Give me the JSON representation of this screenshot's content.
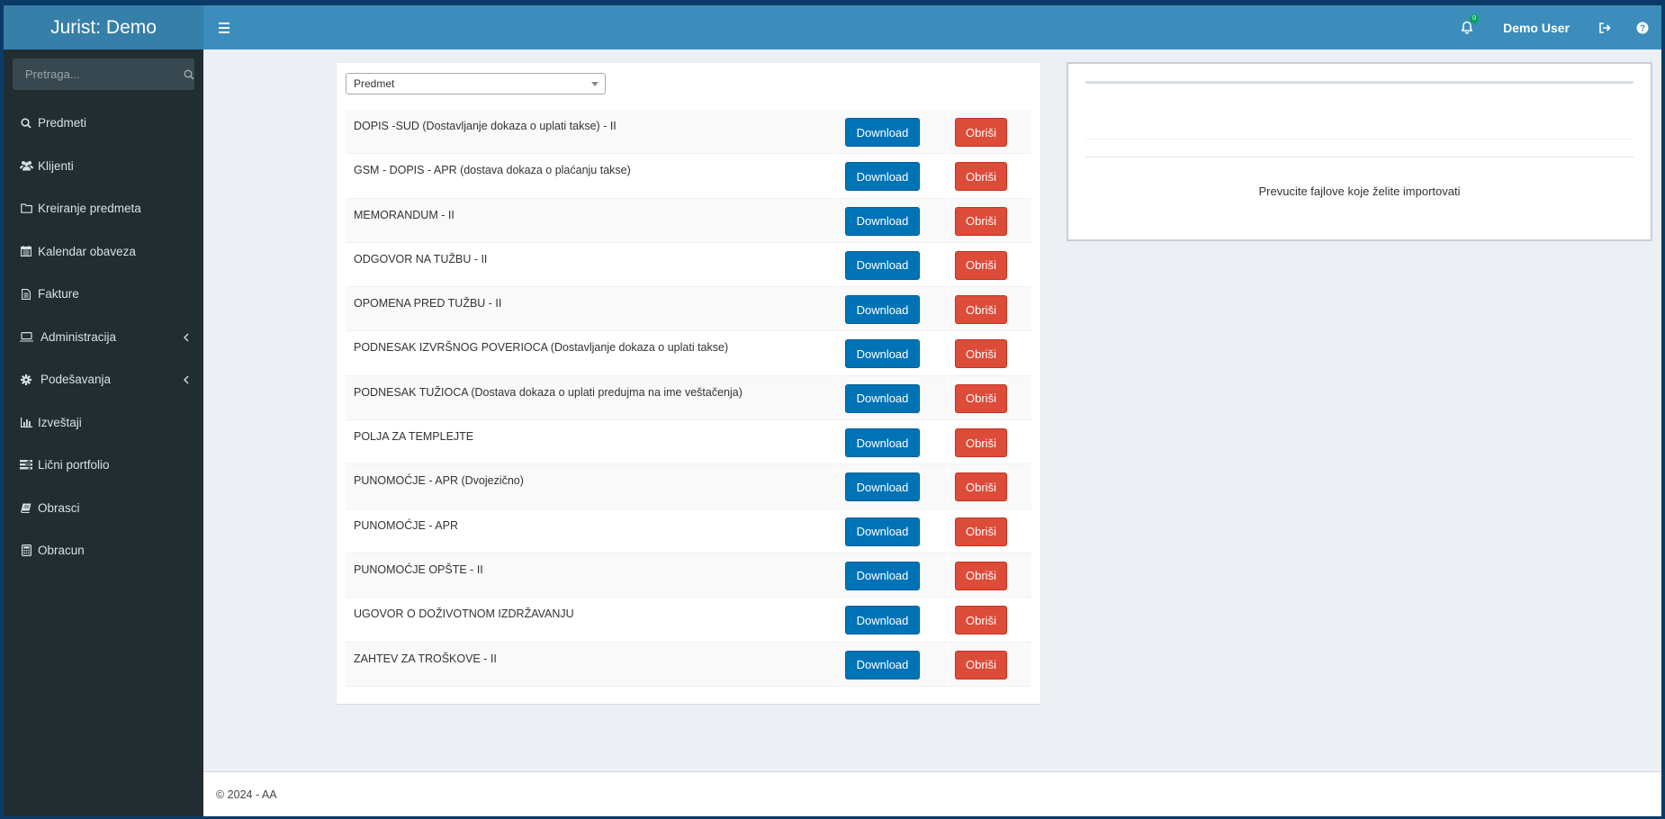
{
  "app": {
    "brand": "Jurist: Demo"
  },
  "header": {
    "notification_count": "0",
    "user_name": "Demo User"
  },
  "sidebar": {
    "search_placeholder": "Pretraga...",
    "items": [
      {
        "label": "Predmeti",
        "icon": "search-icon"
      },
      {
        "label": "Klijenti",
        "icon": "users-icon"
      },
      {
        "label": "Kreiranje predmeta",
        "icon": "folder-icon"
      },
      {
        "label": "Kalendar obaveza",
        "icon": "calendar-icon"
      },
      {
        "label": "Fakture",
        "icon": "document-icon"
      },
      {
        "label": "Administracija",
        "icon": "laptop-icon",
        "expandable": true
      },
      {
        "label": "Podešavanja",
        "icon": "gear-icon",
        "expandable": true
      },
      {
        "label": "Izveštaji",
        "icon": "bar-chart-icon"
      },
      {
        "label": "Lični portfolio",
        "icon": "portfolio-icon"
      },
      {
        "label": "Obrasci",
        "icon": "book-icon"
      },
      {
        "label": "Obracun",
        "icon": "calculator-icon"
      }
    ]
  },
  "templates": {
    "select_value": "Predmet",
    "download_label": "Download",
    "delete_label": "Obriši",
    "rows": [
      "DOPIS -SUD (Dostavljanje dokaza o uplati takse) - II",
      "GSM - DOPIS - APR (dostava dokaza o plaćanju takse)",
      "MEMORANDUM - II",
      "ODGOVOR NA TUŽBU - II",
      "OPOMENA PRED TUŽBU - II",
      "PODNESAK IZVRŠNOG POVERIOCA (Dostavljanje dokaza o uplati takse)",
      "PODNESAK TUŽIOCA (Dostava dokaza o uplati predujma na ime veštačenja)",
      "POLJA ZA TEMPLEJTE",
      "PUNOMOĆJE - APR (Dvojezično)",
      "PUNOMOĆJE - APR",
      "PUNOMOĆJE OPŠTE - II",
      "UGOVOR O DOŽIVOTNOM IZDRŽAVANJU",
      "ZAHTEV ZA TROŠKOVE - II"
    ]
  },
  "dropzone": {
    "text": "Prevucite fajlove koje želite importovati"
  },
  "footer": {
    "text": "© 2024 - AA"
  },
  "colors": {
    "header": "#3c8dbc",
    "brand": "#367fa9",
    "sidebar": "#222d32",
    "download": "#0073b7",
    "delete": "#dd4b39"
  }
}
